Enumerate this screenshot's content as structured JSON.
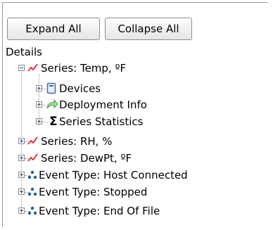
{
  "toolbar": {
    "expand_all": "Expand All",
    "collapse_all": "Collapse All"
  },
  "tree": {
    "root_label": "Details",
    "items": [
      {
        "label": "Series: Temp, ºF",
        "icon": "series-line-icon",
        "state": "expanded",
        "children": [
          {
            "label": "Devices",
            "icon": "device-icon"
          },
          {
            "label": "Deployment Info",
            "icon": "deployment-arrow-icon"
          },
          {
            "label": "Series Statistics",
            "icon": "sigma-icon"
          }
        ]
      },
      {
        "label": "Series: RH, %",
        "icon": "series-line-icon",
        "state": "collapsed"
      },
      {
        "label": "Series: DewPt, ºF",
        "icon": "series-line-icon",
        "state": "collapsed"
      },
      {
        "label": "Event Type: Host Connected",
        "icon": "event-type-icon",
        "state": "collapsed"
      },
      {
        "label": "Event Type: Stopped",
        "icon": "event-type-icon",
        "state": "collapsed"
      },
      {
        "label": "Event Type: End Of File",
        "icon": "event-type-icon",
        "state": "collapsed"
      }
    ]
  },
  "colors": {
    "series_icon": "#d92b2b",
    "event_icon": "#1f5f9e",
    "deployment_icon": "#4da24a",
    "device_icon": "#3f6fb0"
  }
}
